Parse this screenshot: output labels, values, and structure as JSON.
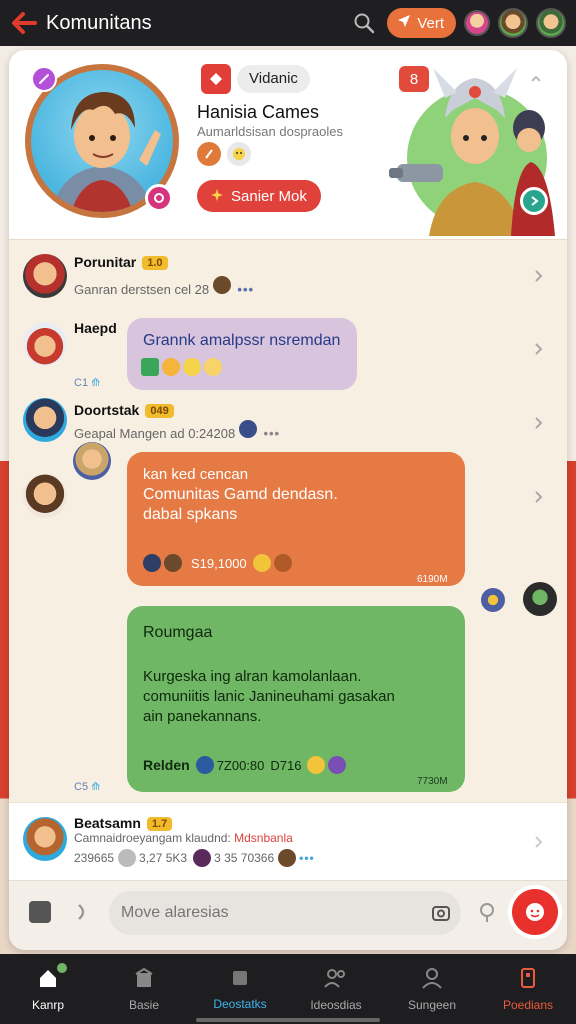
{
  "topbar": {
    "title": "Komunitans",
    "vert_label": "Vert",
    "icons": [
      "back-arrow-icon",
      "search-icon",
      "location-arrow-icon"
    ]
  },
  "profile": {
    "tag_label": "Vidanic",
    "group_name": "Hanisia Cames",
    "group_sub": "Aumarldsisan dospraoles",
    "join_label": "Sanier Mok",
    "count": "8"
  },
  "rows": [
    {
      "name": "Porunitar",
      "level": "1.0",
      "sub": "Ganran derstsen cel 28"
    },
    {
      "name": "Haepd"
    },
    {
      "name": "Doortstak",
      "level": "049",
      "sub": "Geapal Mangen ad 0:24208"
    },
    {
      "name": "Beatsamn",
      "level": "1.7",
      "sub_a": "Camnaidroeyangam klaudnd:",
      "sub_tag": "Mdsnbanla",
      "sub_b1": "239665",
      "sub_b2": "3,27 5K3",
      "sub_b3": "3 35 70366"
    }
  ],
  "bubbles": {
    "pink": {
      "text": "Grannk amalpssr nsremdan",
      "time": "C1"
    },
    "orange": {
      "line1": "kan ked cencan",
      "line2": "Comunitas Gamd dendasn.",
      "line3": "dabal spkans",
      "stat": "S19,1000",
      "time": "6190M"
    },
    "green": {
      "title": "Roumgaa",
      "line1": "Kurgeska ing alran kamolanlaan.",
      "line2": "comuniitis lanic Janineuhami gasakan",
      "line3": "ain panekannans.",
      "footer_name": "Relden",
      "footer_stat1": "7Z00:80",
      "footer_stat2": "D716",
      "time": "7730M",
      "outer_time": "C5"
    }
  },
  "input": {
    "placeholder": "Move alaresias"
  },
  "nav": [
    {
      "label": "Kanrp",
      "icon": "home-icon"
    },
    {
      "label": "Basie",
      "icon": "building-icon"
    },
    {
      "label": "Deostatks",
      "icon": "square-icon"
    },
    {
      "label": "Ideosdias",
      "icon": "people-icon"
    },
    {
      "label": "Sungeen",
      "icon": "person-icon"
    },
    {
      "label": "Poedians",
      "icon": "phone-icon"
    }
  ],
  "colors": {
    "accent_red": "#e0413b",
    "accent_orange": "#e57a45",
    "accent_green": "#6fb764",
    "bubble_pink": "#d9c4dd",
    "level_badge": "#f1bb2b",
    "topbar": "#1f1f22"
  }
}
